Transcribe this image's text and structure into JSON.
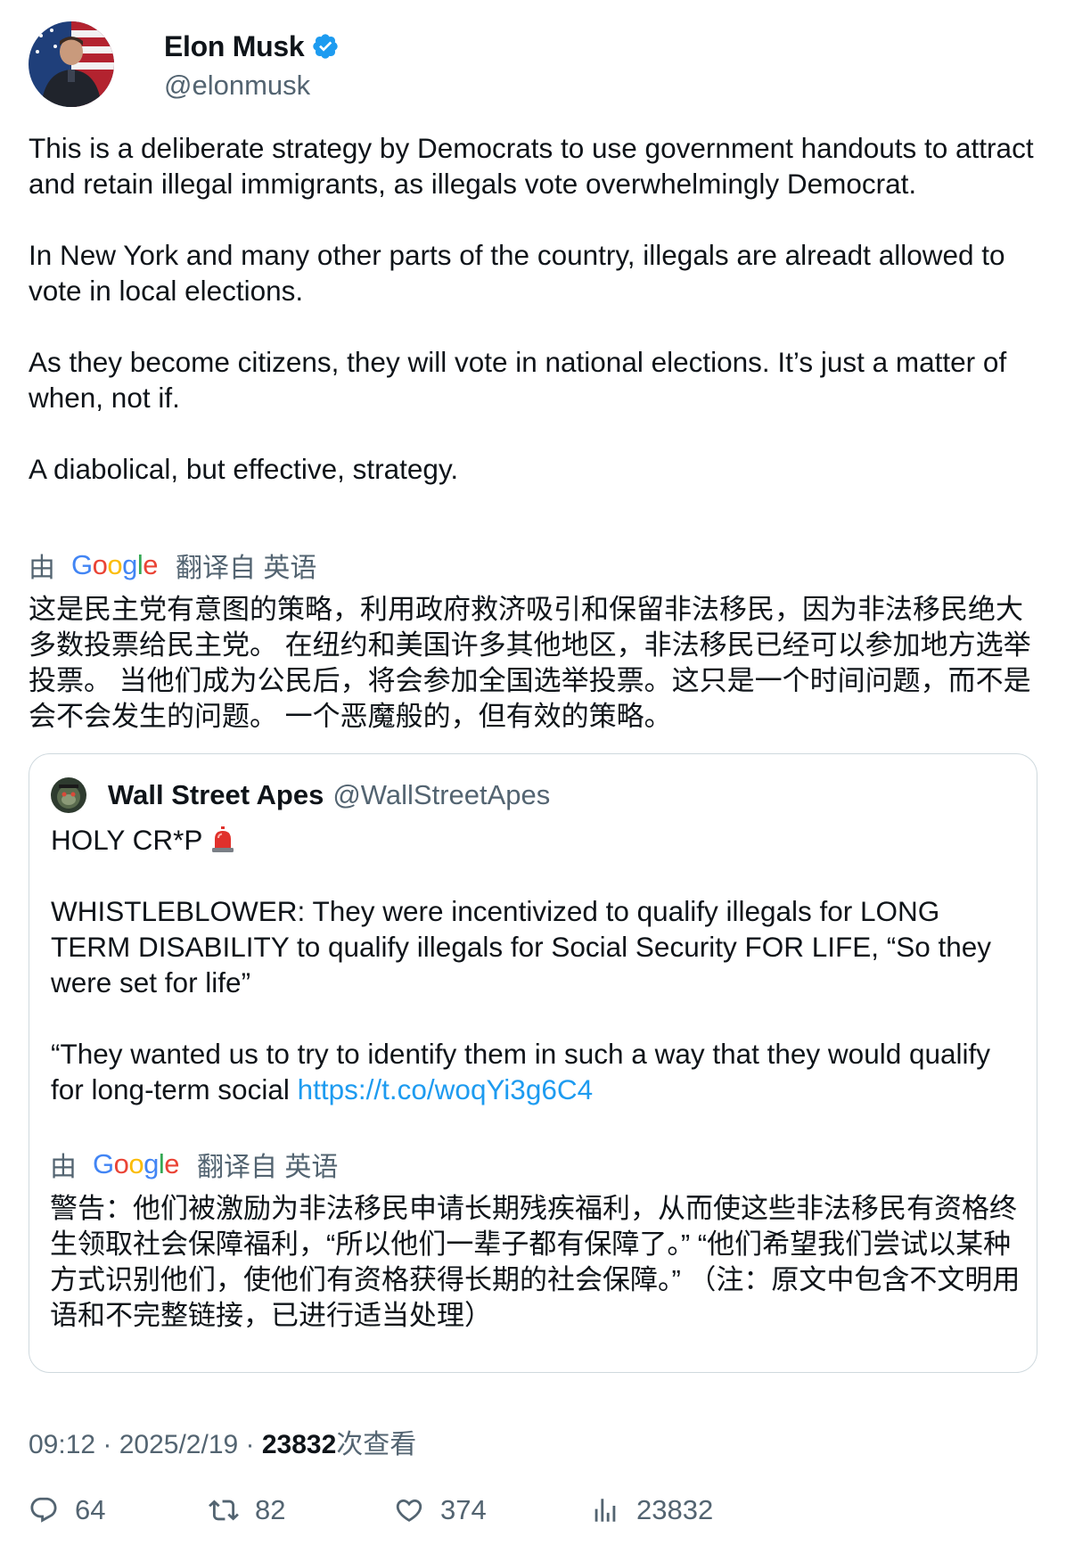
{
  "author": {
    "display_name": "Elon Musk",
    "handle": "@elonmusk"
  },
  "tweet": {
    "text": "This is a deliberate strategy by Democrats to use government handouts to attract and retain illegal immigrants, as illegals vote overwhelmingly Democrat.\n\nIn New York and many other parts of the country, illegals are alreadt allowed to vote in local elections.\n\nAs they become citizens, they will vote in national elections. It’s just a matter of when, not if.\n\nA diabolical, but effective, strategy.",
    "translation_by": "由",
    "translation_from": "翻译自 英语",
    "translation": "这是民主党有意图的策略，利用政府救济吸引和保留非法移民，因为非法移民绝大多数投票给民主党。 在纽约和美国许多其他地区，非法移民已经可以参加地方选举投票。 当他们成为公民后，将会参加全国选举投票。这只是一个时间问题，而不是会不会发生的问题。 一个恶魔般的，但有效的策略。"
  },
  "quote": {
    "display_name": "Wall Street Apes",
    "handle": "@WallStreetApes",
    "text_line1": "HOLY CR*P ",
    "text_body": "\n\nWHISTLEBLOWER: They were incentivized to qualify illegals for LONG TERM DISABILITY to qualify illegals for Social Security FOR LIFE, “So they were set for life”\n\n“They wanted us to try to identify them in such a way that they would qualify for long-term social ",
    "link": "https://t.co/woqYi3g6C4",
    "translation_by": "由",
    "translation_from": "翻译自 英语",
    "translation": "警告：他们被激励为非法移民申请长期残疾福利，从而使这些非法移民有资格终生领取社会保障福利，“所以他们一辈子都有保障了。” “他们希望我们尝试以某种方式识别他们，使他们有资格获得长期的社会保障。” （注：原文中包含不文明用语和不完整链接，已进行适当处理）"
  },
  "google_logo": [
    "G",
    "o",
    "o",
    "g",
    "l",
    "e"
  ],
  "meta": {
    "time": "09:12 · 2025/2/19 · ",
    "views_count": "23832",
    "views_label": "次查看"
  },
  "actions": {
    "replies": "64",
    "reposts": "82",
    "likes": "374",
    "views": "23832"
  },
  "colors": {
    "link": "#1d9bf0",
    "verified": "#1d9bf0",
    "secondary_text": "#536471"
  },
  "icons": [
    "verified-icon",
    "siren-icon",
    "reply-icon",
    "repost-icon",
    "like-icon",
    "views-icon"
  ]
}
